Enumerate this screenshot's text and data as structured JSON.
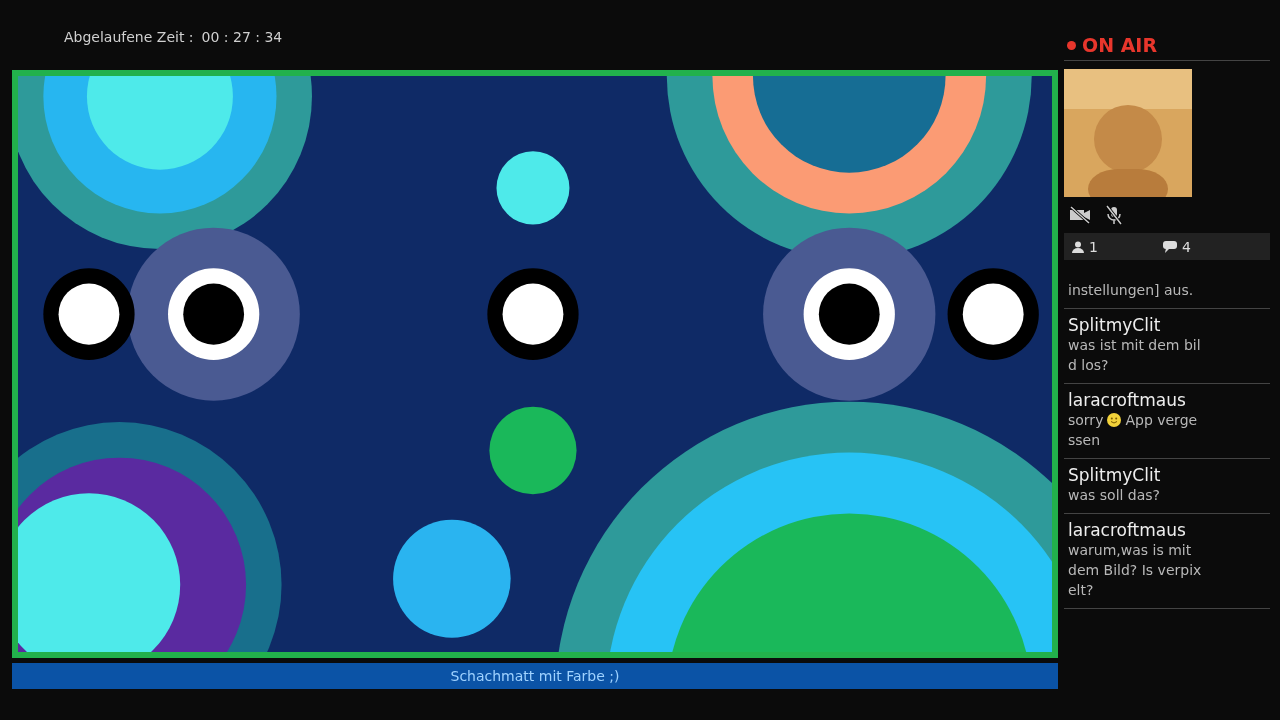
{
  "elapsed": {
    "label": "Abgelaufene Zeit :",
    "value": "00 : 27 : 34"
  },
  "stream": {
    "kind": "picture",
    "caption": "Schachmatt mit Farbe ;)"
  },
  "sidebar": {
    "status": "ON AIR",
    "live": true,
    "camera_on": false,
    "mic_on": false,
    "viewers": "1",
    "comments": "4"
  },
  "chat": [
    {
      "lines": [
        [
          {
            "kind": "text",
            "text": "instellungen] aus."
          }
        ]
      ]
    },
    {
      "author": "SplitmyClit",
      "lines": [
        [
          {
            "kind": "text",
            "text": "was ist mit dem bil"
          }
        ],
        [
          {
            "kind": "text",
            "text": "d los?"
          }
        ]
      ]
    },
    {
      "author": "laracroftmaus",
      "lines": [
        [
          {
            "kind": "text",
            "text": "sorry"
          },
          {
            "kind": "emoji"
          },
          {
            "kind": "text",
            "text": "App verge"
          }
        ],
        [
          {
            "kind": "text",
            "text": "ssen"
          }
        ]
      ]
    },
    {
      "author": "SplitmyClit",
      "lines": [
        [
          {
            "kind": "text",
            "text": "was soll das?"
          }
        ]
      ]
    },
    {
      "author": "laracroftmaus",
      "lines": [
        [
          {
            "kind": "text",
            "text": "warum,was is mit"
          }
        ],
        [
          {
            "kind": "text",
            "text": "dem Bild? Is verpix"
          }
        ],
        [
          {
            "kind": "text",
            "text": "elt?"
          }
        ]
      ]
    }
  ]
}
